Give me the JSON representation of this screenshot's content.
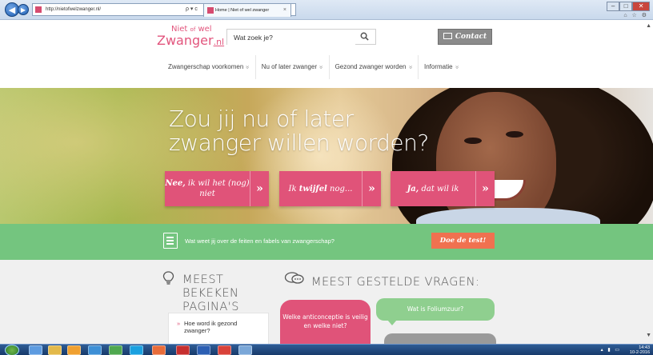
{
  "browser": {
    "url": "http://nietofwelzwanger.nl/",
    "address_tools": "ρ ▾ c",
    "tab_title": "Home | Niet of wel zwanger",
    "tab_close": "×",
    "back_symbol": "◀",
    "forward_symbol": "▶",
    "window_controls": [
      "–",
      "□",
      "✕"
    ],
    "chrome_icons": "⌂ ☆ ⚙"
  },
  "site": {
    "logo_top": "Niet",
    "logo_of": "of",
    "logo_wel": "wel",
    "logo_main": "Zwanger",
    "logo_tld": ".nl",
    "search_placeholder": "Wat zoek je?",
    "contact_label": "Contact",
    "nav": [
      {
        "label": "Zwangerschap voorkomen",
        "chev": "»"
      },
      {
        "label": "Nu of later zwanger",
        "chev": "»"
      },
      {
        "label": "Gezond zwanger worden",
        "chev": "»"
      },
      {
        "label": "Informatie",
        "chev": "»"
      }
    ]
  },
  "hero": {
    "title_line1": "Zou jij nu of later",
    "title_line2": "zwanger willen worden?",
    "choices": [
      {
        "bold": "Nee,",
        "rest": " ik wil het (nog) niet",
        "arrow": "»"
      },
      {
        "pre": "Ik ",
        "bold": "twijfel",
        "rest": " nog...",
        "arrow": "»"
      },
      {
        "bold": "Ja,",
        "rest": " dat wil ik",
        "arrow": "»"
      }
    ]
  },
  "quiz": {
    "text": "Wat weet jij over de feiten en fabels van zwangerschap?",
    "button": "Doe de test!"
  },
  "lower": {
    "most_viewed_line1": "Meest bekeken",
    "most_viewed_line2": "pagina's",
    "most_asked": "Meest gestelde vragen:",
    "card_item": "Hoe word ik gezond zwanger?",
    "bubble_pink": "Welke anticonceptie is veilig en welke niet?",
    "bubble_green": "Wat is Foliumzuur?"
  },
  "taskbar": {
    "time": "14:43",
    "date": "10-2-2016",
    "tray_icons": "▴ ▮ ▭"
  },
  "colors": {
    "brand_pink": "#e05379",
    "green_bar": "#74c57f",
    "test_button": "#f07150"
  }
}
